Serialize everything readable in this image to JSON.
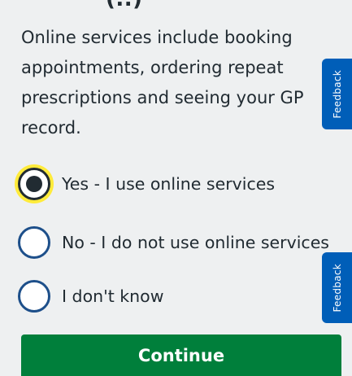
{
  "header": {
    "cut_off_text": "(..)"
  },
  "question": {
    "hint": "Online services include booking appointments, ordering repeat prescriptions and seeing your GP record."
  },
  "options": [
    {
      "label": "Yes - I use online services",
      "selected": true
    },
    {
      "label": "No - I do not use online services",
      "selected": false
    },
    {
      "label": "I don't know",
      "selected": false
    }
  ],
  "feedback_tabs": [
    {
      "label": "Feedback"
    },
    {
      "label": "Feedback"
    }
  ],
  "continue_button": {
    "label": "Continue"
  },
  "colors": {
    "background": "#eef0f1",
    "primary_button": "#007f3b",
    "feedback_tab": "#005eb8",
    "radio_border": "#1d4f8a",
    "focus_highlight": "#ffeb3b",
    "text": "#212b32"
  }
}
